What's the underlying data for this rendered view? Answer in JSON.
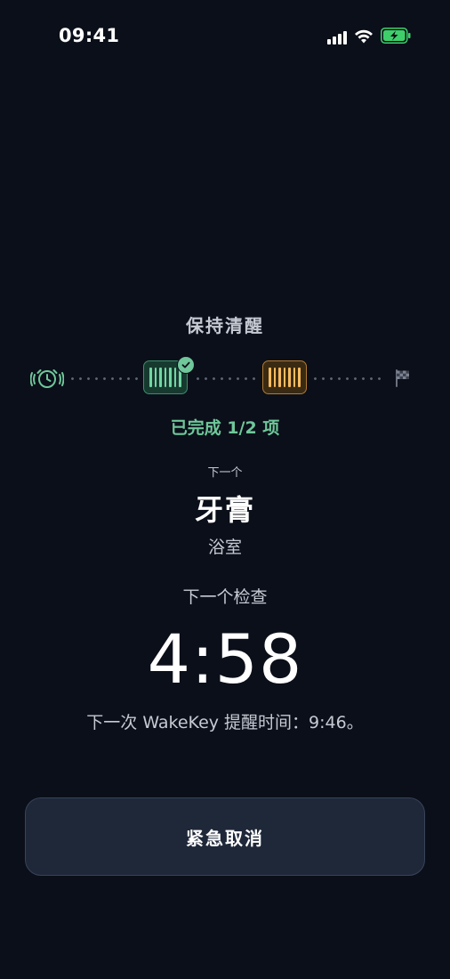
{
  "status_bar": {
    "time": "09:41",
    "icons": [
      "cellular-signal-icon",
      "wifi-icon",
      "battery-charging-icon"
    ]
  },
  "screen": {
    "title": "保持清醒",
    "progress": {
      "steps": [
        {
          "icon": "alarm-icon",
          "state": "start"
        },
        {
          "icon": "barcode-icon",
          "state": "done"
        },
        {
          "icon": "barcode-icon",
          "state": "current"
        },
        {
          "icon": "finish-flag-icon",
          "state": "end"
        }
      ],
      "completed_text": "已完成 1/2 项",
      "completed_fraction": 0.5
    },
    "next_label": "下一个",
    "next_item": "牙膏",
    "next_location": "浴室",
    "next_check_label": "下一个检查",
    "countdown": "4:58",
    "next_wakekey_text": "下一次 WakeKey 提醒时间：9:46。"
  },
  "actions": {
    "cancel_label": "紧急取消"
  },
  "colors": {
    "background": "#0b0f19",
    "success": "#6fc79a",
    "current": "#f5bb60",
    "button": "#1f2839"
  }
}
